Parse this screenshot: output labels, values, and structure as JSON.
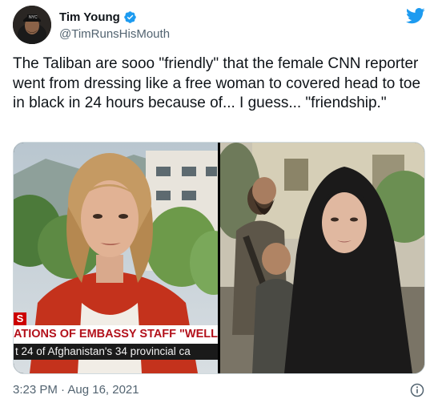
{
  "author": {
    "display_name": "Tim Young",
    "handle": "@TimRunsHisMouth",
    "avatar_cap_text": "NYC",
    "verified": true
  },
  "tweet": {
    "text": "The Taliban are sooo \"friendly\" that the female CNN reporter went from dressing like a free woman to covered head to toe in black in 24 hours because of... I guess... \"friendship.\"",
    "timestamp": "3:23 PM · Aug 16, 2021"
  },
  "media": {
    "left_photo": {
      "ticker_tag": "S",
      "ticker_headline": "ATIONS OF EMBASSY STAFF \"WELL UNDEI",
      "ticker_sub": "t 24 of Afghanistan's 34 provincial ca"
    }
  },
  "colors": {
    "brand_blue": "#1d9bf0",
    "text_primary": "#0f1419",
    "text_secondary": "#536471",
    "cnn_red": "#b3111b"
  },
  "icons": {
    "logo": "twitter-bird-icon",
    "verified": "verified-badge-icon",
    "info": "info-icon"
  }
}
